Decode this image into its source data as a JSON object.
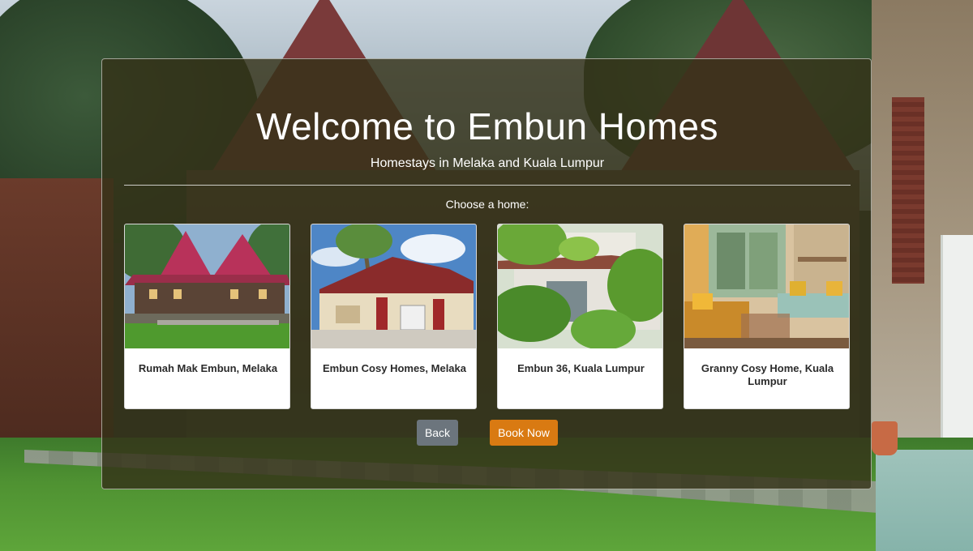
{
  "hero": {
    "title": "Welcome to Embun Homes",
    "subtitle": "Homestays in Melaka and Kuala Lumpur"
  },
  "chooser": {
    "prompt": "Choose a home:",
    "homes": [
      {
        "name": "Rumah Mak Embun, Melaka"
      },
      {
        "name": "Embun Cosy Homes, Melaka"
      },
      {
        "name": "Embun 36, Kuala Lumpur"
      },
      {
        "name": "Granny Cosy Home, Kuala Lumpur"
      }
    ]
  },
  "actions": {
    "back_label": "Back",
    "book_label": "Book Now"
  },
  "colors": {
    "panel_bg": "#34321980",
    "back_button": "#6c757d",
    "book_button": "#d97a12"
  }
}
